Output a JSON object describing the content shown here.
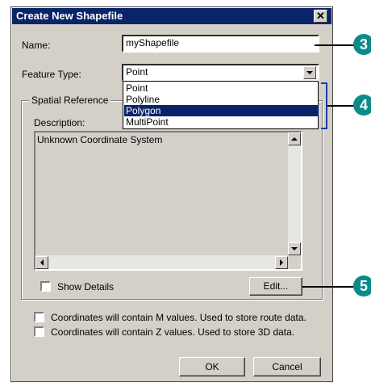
{
  "dialog": {
    "title": "Create New Shapefile",
    "close_glyph": "✕"
  },
  "name": {
    "label": "Name:",
    "value": "myShapefile"
  },
  "feature_type": {
    "label": "Feature Type:",
    "selected": "Point",
    "options": [
      "Point",
      "Polyline",
      "Polygon",
      "MultiPoint"
    ],
    "highlighted": "Polygon"
  },
  "spatial_reference": {
    "group_label": "Spatial Reference",
    "description_label": "Description:",
    "description_text": "Unknown Coordinate System",
    "show_details_label": "Show Details",
    "edit_button": "Edit..."
  },
  "options": {
    "m_values": "Coordinates will contain M values. Used to store route data.",
    "z_values": "Coordinates will contain Z values. Used to store 3D data."
  },
  "buttons": {
    "ok": "OK",
    "cancel": "Cancel"
  },
  "callouts": [
    "3",
    "4",
    "5"
  ],
  "colors": {
    "title_bar": "#0a246a",
    "callout": "#0b8a8a",
    "bracket": "#1a3ea8"
  }
}
